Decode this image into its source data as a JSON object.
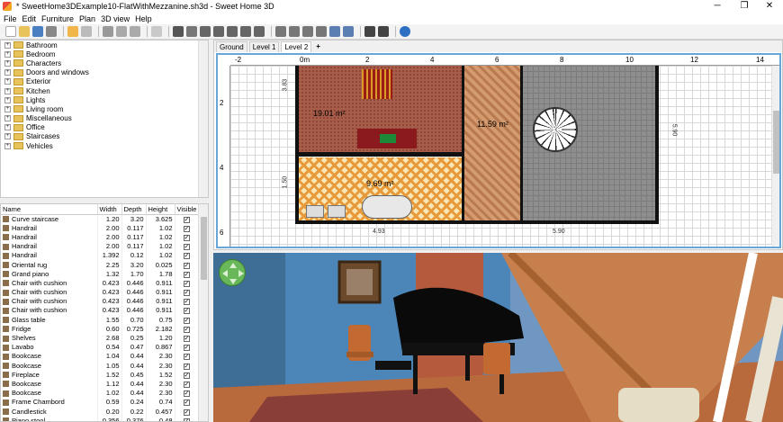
{
  "window": {
    "title": "* SweetHome3DExample10-FlatWithMezzanine.sh3d - Sweet Home 3D",
    "minimize": "─",
    "maximize": "❐",
    "close": "✕"
  },
  "menu": [
    "File",
    "Edit",
    "Furniture",
    "Plan",
    "3D view",
    "Help"
  ],
  "catalog": {
    "categories": [
      "Bathroom",
      "Bedroom",
      "Characters",
      "Doors and windows",
      "Exterior",
      "Kitchen",
      "Lights",
      "Living room",
      "Miscellaneous",
      "Office",
      "Staircases",
      "Vehicles"
    ]
  },
  "furniture": {
    "columns": [
      "Name",
      "Width",
      "Depth",
      "Height",
      "Visible"
    ],
    "rows": [
      [
        "Curve staircase",
        "1.20",
        "3.20",
        "3.625"
      ],
      [
        "Handrail",
        "2.00",
        "0.117",
        "1.02"
      ],
      [
        "Handrail",
        "2.00",
        "0.117",
        "1.02"
      ],
      [
        "Handrail",
        "2.00",
        "0.117",
        "1.02"
      ],
      [
        "Handrail",
        "1.392",
        "0.12",
        "1.02"
      ],
      [
        "Oriental rug",
        "2.25",
        "3.20",
        "0.025"
      ],
      [
        "Grand piano",
        "1.32",
        "1.70",
        "1.78"
      ],
      [
        "Chair with cushion",
        "0.423",
        "0.446",
        "0.911"
      ],
      [
        "Chair with cushion",
        "0.423",
        "0.446",
        "0.911"
      ],
      [
        "Chair with cushion",
        "0.423",
        "0.446",
        "0.911"
      ],
      [
        "Chair with cushion",
        "0.423",
        "0.446",
        "0.911"
      ],
      [
        "Glass table",
        "1.55",
        "0.70",
        "0.75"
      ],
      [
        "Fridge",
        "0.60",
        "0.725",
        "2.182"
      ],
      [
        "Shelves",
        "2.68",
        "0.25",
        "1.20"
      ],
      [
        "Lavabo",
        "0.54",
        "0.47",
        "0.867"
      ],
      [
        "Bookcase",
        "1.04",
        "0.44",
        "2.30"
      ],
      [
        "Bookcase",
        "1.05",
        "0.44",
        "2.30"
      ],
      [
        "Fireplace",
        "1.52",
        "0.45",
        "1.52"
      ],
      [
        "Bookcase",
        "1.12",
        "0.44",
        "2.30"
      ],
      [
        "Bookcase",
        "1.02",
        "0.44",
        "2.30"
      ],
      [
        "Frame Chambord",
        "0.59",
        "0.24",
        "0.74"
      ],
      [
        "Candlestick",
        "0.20",
        "0.22",
        "0.457"
      ],
      [
        "Piano stool",
        "0.356",
        "0.376",
        "0.48"
      ]
    ]
  },
  "plan": {
    "tabs": [
      "Ground",
      "Level 1",
      "Level 2",
      "+"
    ],
    "active_tab": "Level 2",
    "ruler_top": [
      "-2",
      "0m",
      "2",
      "4",
      "6",
      "8",
      "10",
      "12",
      "14"
    ],
    "ruler_left": [
      "2",
      "4",
      "6"
    ],
    "rooms": [
      {
        "label": "19.01 m²"
      },
      {
        "label": "11.59 m²"
      },
      {
        "label": "9.69 m²"
      }
    ],
    "dimensions": [
      "4.93",
      "5.90",
      "3.83",
      "1.50",
      "5.90"
    ]
  },
  "view3d": {}
}
